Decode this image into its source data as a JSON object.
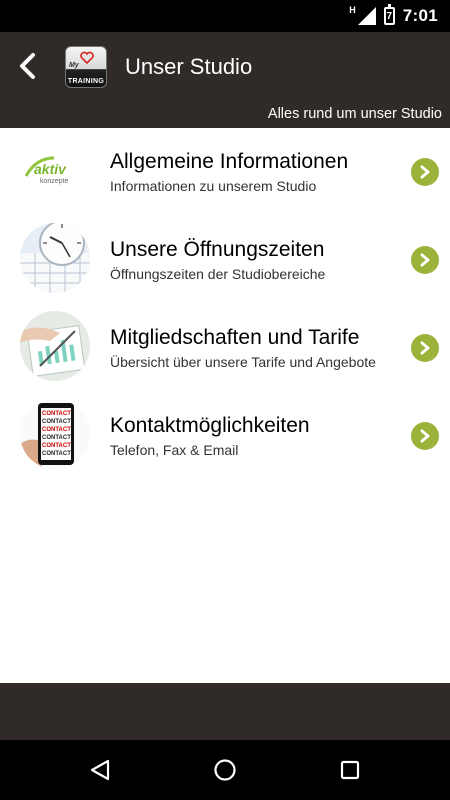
{
  "status_bar": {
    "network_indicator": "H",
    "battery_label": "7",
    "time": "7:01",
    "icons": [
      "signal-icon",
      "battery-icon"
    ]
  },
  "header": {
    "title": "Unser Studio",
    "subtitle": "Alles rund um unser Studio",
    "logo": {
      "prefix": "My",
      "text": "TRAINING"
    },
    "back_icon": "chevron-left-icon"
  },
  "items": [
    {
      "title": "Allgemeine Informationen",
      "subtitle": "Informationen zu unserem Studio",
      "thumb": "aktiv-konzepte-logo",
      "thumb_text": [
        "aktiv",
        "konzepte"
      ]
    },
    {
      "title": "Unsere Öffnungszeiten",
      "subtitle": "Öffnungszeiten der Studiobereiche",
      "thumb": "clock-calendar-image"
    },
    {
      "title": "Mitgliedschaften und Tarife",
      "subtitle": "Übersicht über unsere Tarife und Angebote",
      "thumb": "documents-image"
    },
    {
      "title": "Kontaktmöglichkeiten",
      "subtitle": "Telefon, Fax & Email",
      "thumb": "phone-contact-image",
      "thumb_text": [
        "CONTACT",
        "CONTACT",
        "CONTACT",
        "CONTACT",
        "CONTACT",
        "CONTACT"
      ]
    }
  ],
  "colors": {
    "header_bg": "#302b28",
    "accent_green": "#9cb33b",
    "status_bar_bg": "#000000"
  },
  "nav": {
    "icons": [
      "back-triangle-icon",
      "home-circle-icon",
      "recents-square-icon"
    ]
  }
}
